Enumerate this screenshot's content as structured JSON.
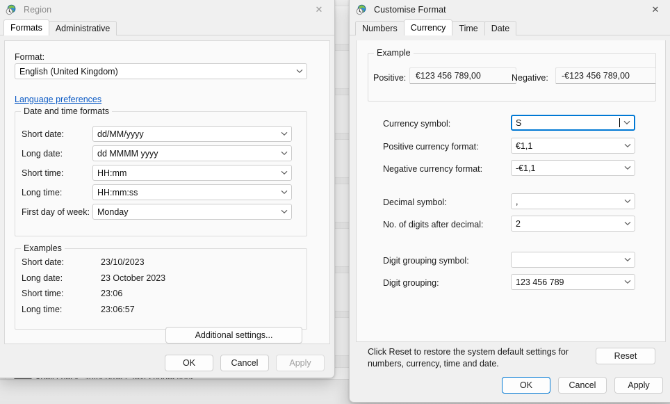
{
  "backdrop": {
    "setting_row_label": "Spell check, autocorrect, text suggestions",
    "keyboard_icon": "keyboard-icon"
  },
  "region_dialog": {
    "title": "Region",
    "icon": "region-globe-clock-icon",
    "close_label": "✕",
    "tabs": [
      {
        "label": "Formats",
        "active": true
      },
      {
        "label": "Administrative",
        "active": false
      }
    ],
    "format_label": "Format:",
    "format_value": "English (United Kingdom)",
    "language_preferences_link": "Language preferences",
    "datetime_group": {
      "legend": "Date and time formats",
      "rows": [
        {
          "label": "Short date:",
          "value": "dd/MM/yyyy"
        },
        {
          "label": "Long date:",
          "value": "dd MMMM yyyy"
        },
        {
          "label": "Short time:",
          "value": "HH:mm"
        },
        {
          "label": "Long time:",
          "value": "HH:mm:ss"
        },
        {
          "label": "First day of week:",
          "value": "Monday"
        }
      ]
    },
    "examples_group": {
      "legend": "Examples",
      "rows": [
        {
          "label": "Short date:",
          "value": "23/10/2023"
        },
        {
          "label": "Long date:",
          "value": "23 October 2023"
        },
        {
          "label": "Short time:",
          "value": "23:06"
        },
        {
          "label": "Long time:",
          "value": "23:06:57"
        }
      ]
    },
    "additional_settings_button": "Additional settings...",
    "buttons": {
      "ok": "OK",
      "cancel": "Cancel",
      "apply": "Apply"
    }
  },
  "customise_dialog": {
    "title": "Customise Format",
    "icon": "region-globe-clock-icon",
    "close_label": "✕",
    "tabs": [
      {
        "label": "Numbers",
        "active": false
      },
      {
        "label": "Currency",
        "active": true
      },
      {
        "label": "Time",
        "active": false
      },
      {
        "label": "Date",
        "active": false
      }
    ],
    "example_group": {
      "legend": "Example",
      "positive_label": "Positive:",
      "positive_value": "€123 456 789,00",
      "negative_label": "Negative:",
      "negative_value": "-€123 456 789,00"
    },
    "fields": [
      {
        "label": "Currency symbol:",
        "value": "S",
        "focused": true
      },
      {
        "label": "Positive currency format:",
        "value": "€1,1",
        "focused": false
      },
      {
        "label": "Negative currency format:",
        "value": "-€1,1",
        "focused": false
      },
      {
        "label": "Decimal symbol:",
        "value": ",",
        "focused": false
      },
      {
        "label": "No. of digits after decimal:",
        "value": "2",
        "focused": false
      },
      {
        "label": "Digit grouping symbol:",
        "value": "",
        "focused": false
      },
      {
        "label": "Digit grouping:",
        "value": "123 456 789",
        "focused": false
      }
    ],
    "reset_text_line1": "Click Reset to restore the system default settings for",
    "reset_text_line2": "numbers, currency, time and date.",
    "reset_button": "Reset",
    "buttons": {
      "ok": "OK",
      "cancel": "Cancel",
      "apply": "Apply"
    }
  },
  "colors": {
    "accent": "#0078d4",
    "link": "#0a59c4",
    "dialog_bg": "#f0f0f0",
    "panel_bg": "#fafafa"
  }
}
